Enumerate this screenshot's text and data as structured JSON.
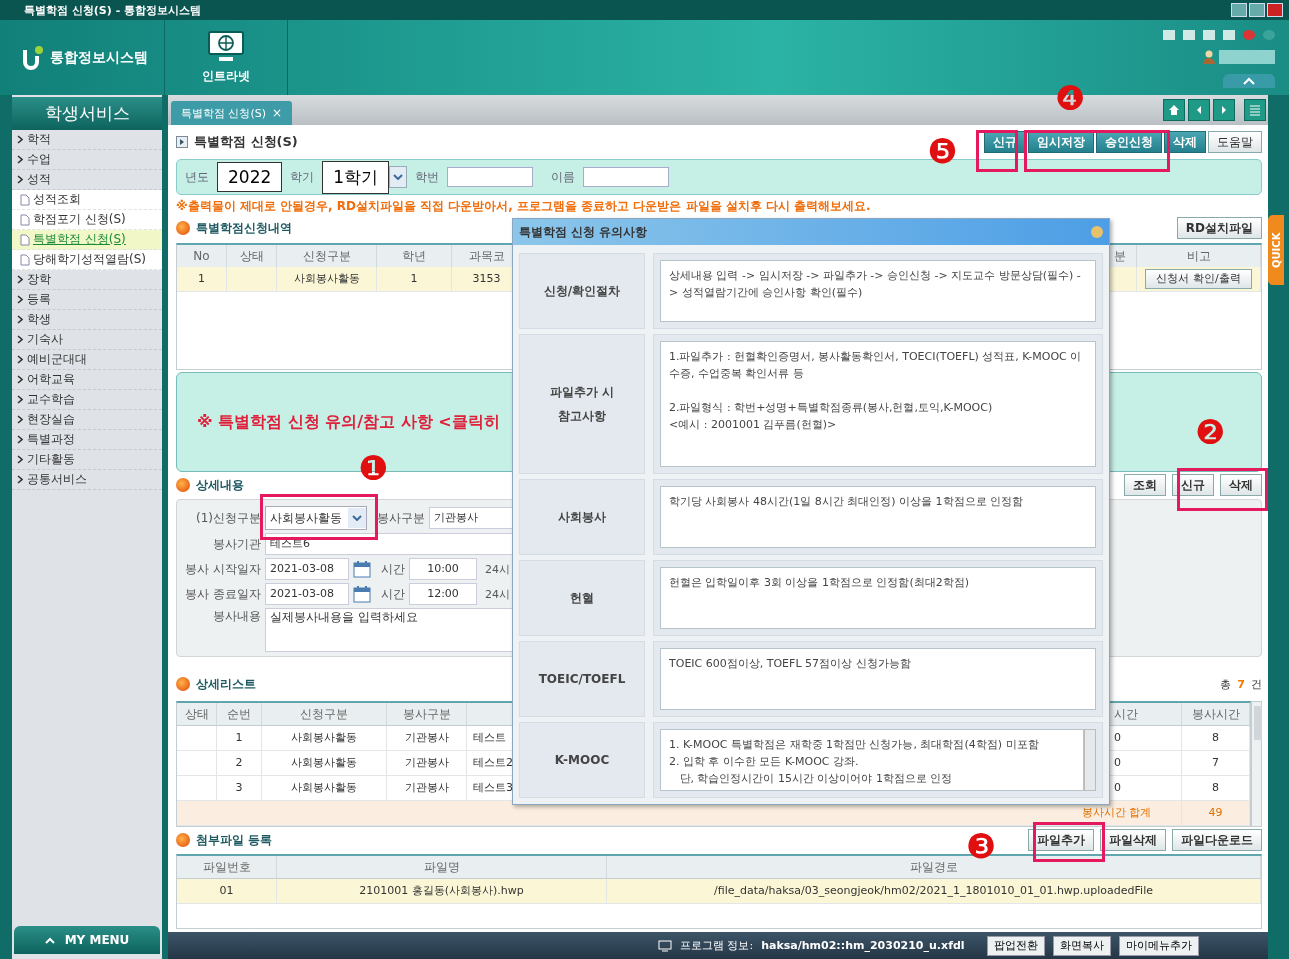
{
  "window": {
    "title": "특별학점 신청(S) - 통합정보시스템"
  },
  "header": {
    "logo": "통합정보시스템",
    "launcher": "인트라넷"
  },
  "sidebar": {
    "title": "학생서비스",
    "footer": "MY MENU",
    "items": [
      {
        "label": "학적"
      },
      {
        "label": "수업"
      },
      {
        "label": "성적",
        "children": [
          {
            "label": "성적조회",
            "selected": false
          },
          {
            "label": "학점포기 신청(S)",
            "selected": false
          },
          {
            "label": "특별학점 신청(S)",
            "selected": true
          },
          {
            "label": "당해학기성적열람(S)",
            "selected": false
          }
        ]
      },
      {
        "label": "장학"
      },
      {
        "label": "등록"
      },
      {
        "label": "학생"
      },
      {
        "label": "기숙사"
      },
      {
        "label": "예비군대대"
      },
      {
        "label": "어학교육"
      },
      {
        "label": "교수학습"
      },
      {
        "label": "현장실습"
      },
      {
        "label": "특별과정"
      },
      {
        "label": "기타활동"
      },
      {
        "label": "공통서비스"
      }
    ]
  },
  "tabs": [
    {
      "label": "특별학점 신청(S)",
      "close": "×",
      "selected": true
    }
  ],
  "page": {
    "title": "특별학점 신청(S)",
    "buttons": [
      {
        "label": "신규",
        "kind": "primary"
      },
      {
        "label": "임시저장",
        "kind": "primary"
      },
      {
        "label": "승인신청",
        "kind": "primary"
      },
      {
        "label": "삭제",
        "kind": "primary"
      },
      {
        "label": "도움말",
        "kind": "plain"
      }
    ]
  },
  "search": [
    {
      "label": "년도",
      "value": "2022",
      "kind": "text"
    },
    {
      "label": "학기",
      "value": "1학기",
      "kind": "select"
    },
    {
      "label": "학번",
      "kind": "text"
    },
    {
      "label": "이름",
      "kind": "text"
    }
  ],
  "warning": "※출력물이 제대로 안될경우, RD설치파일을 직접 다운받아서, 프로그램을 종료하고 다운받은 파일을 설치후 다시 출력해보세요.",
  "applications": {
    "title": "특별학점신청내역",
    "button": "RD설치파일",
    "columns": [
      "No",
      "상태",
      "신청구분",
      "학년",
      "과목코",
      "분",
      "비고"
    ],
    "rows": [
      {
        "cells": [
          "1",
          "",
          "사회봉사활동",
          "1",
          "3153",
          ""
        ],
        "action": "신청서 확인/출력"
      }
    ]
  },
  "notice": "※ 특별학점 신청 유의/참고 사항 <클릭히",
  "detail": {
    "title": "상세내용",
    "buttons": [
      "조회",
      "신규",
      "삭제"
    ],
    "category": {
      "label": "(1)신청구분",
      "value": "사회봉사활동"
    },
    "service_type": {
      "label": "봉사구분",
      "value": "기관봉사"
    },
    "agency": {
      "label": "봉사기관",
      "value": "테스트6"
    },
    "start": {
      "label": "봉사 시작일자",
      "date": "2021-03-08",
      "time_label": "시간",
      "time": "10:00",
      "unit": "24시"
    },
    "end": {
      "label": "봉사 종료일자",
      "date": "2021-03-08",
      "time_label": "시간",
      "time": "12:00",
      "unit": "24시"
    },
    "content": {
      "label": "봉사내용",
      "value": "실제봉사내용을 입력하세요"
    }
  },
  "detail_list": {
    "title": "상세리스트",
    "total_label": "총",
    "total": "7",
    "total_unit": "건",
    "columns": [
      "상태",
      "순번",
      "신청구분",
      "봉사구분",
      "",
      "시간",
      "봉사시간"
    ],
    "rows": [
      [
        "",
        "1",
        "사회봉사활동",
        "기관봉사",
        "테스트",
        "0",
        "8"
      ],
      [
        "",
        "2",
        "사회봉사활동",
        "기관봉사",
        "테스트2",
        "0",
        "7"
      ],
      [
        "",
        "3",
        "사회봉사활동",
        "기관봉사",
        "테스트3",
        "0",
        "8"
      ]
    ],
    "sum_label": "봉사시간 합계",
    "sum": "49"
  },
  "attachments": {
    "title": "첨부파일 등록",
    "buttons": [
      "파일추가",
      "파일삭제",
      "파일다운로드"
    ],
    "columns": [
      "파일번호",
      "파일명",
      "파일경로"
    ],
    "rows": [
      [
        "01",
        "2101001 홍길동(사회봉사).hwp",
        "/file_data/haksa/03_seongjeok/hm02/2021_1_1801010_01_01.hwp.uploadedFile"
      ]
    ]
  },
  "status_bar": {
    "info_label": "프로그램 정보:",
    "info": "haksa/hm02::hm_2030210_u.xfdl",
    "buttons": [
      "팝업전환",
      "화면복사",
      "마이메뉴추가"
    ]
  },
  "quick": "QUICK",
  "popup": {
    "title": "특별학점 신청 유의사항",
    "rows": [
      {
        "label": "신청/확인절차",
        "text": "상세내용 입력 -> 임시저장 -> 파일추가 -> 승인신청 -> 지도교수 방문상담(필수) -> 성적열람기간에 승인사항 확인(필수)"
      },
      {
        "label": "파일추가 시\n참고사항",
        "text": "1.파일추가 : 헌혈확인증명서, 봉사활동확인서, TOECI(TOEFL) 성적표, K-MOOC 이수증, 수업중복 확인서류 등\n\n2.파일형식 : 학번+성명+특별학점종류(봉사,헌혈,토익,K-MOOC)\n<예시 : 2001001 김푸름(헌혈)>"
      },
      {
        "label": "사회봉사",
        "text": "학기당 사회봉사 48시간(1일 8시간 최대인정) 이상을 1학점으로 인정함"
      },
      {
        "label": "헌혈",
        "text": "헌혈은 입학일이후 3회 이상을 1학점으로 인정함(최대2학점)"
      },
      {
        "label": "TOEIC/TOEFL",
        "text": "TOEIC 600점이상, TOEFL 57점이상 신청가능함"
      },
      {
        "label": "K-MOOC",
        "text": "1. K-MOOC 특별학점은 재학중 1학점만 신청가능, 최대학점(4학점) 미포함\n2. 입학 후 이수한 모든 K-MOOC 강좌.\n   단, 학습인정시간이 15시간 이상이어야 1학점으로 인정"
      }
    ]
  },
  "annotations": [
    {
      "label": "❶"
    },
    {
      "label": "❷"
    },
    {
      "label": "❸"
    },
    {
      "label": "❹"
    },
    {
      "label": "❺"
    }
  ]
}
